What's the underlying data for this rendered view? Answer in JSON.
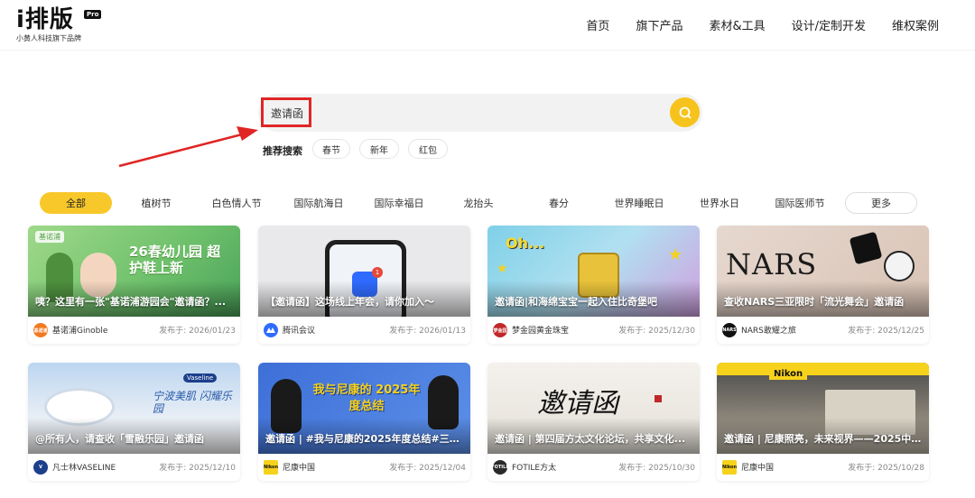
{
  "header": {
    "logo_text": "i排版",
    "logo_badge": "Pro",
    "logo_sub": "小黄人科技旗下品牌",
    "nav": [
      "首页",
      "旗下产品",
      "素材&工具",
      "设计/定制开发",
      "维权案例"
    ]
  },
  "search": {
    "value": "邀请函",
    "recommend_label": "推荐搜索",
    "tags": [
      "春节",
      "新年",
      "红包"
    ]
  },
  "categories": [
    "全部",
    "植树节",
    "白色情人节",
    "国际航海日",
    "国际幸福日",
    "龙抬头",
    "春分",
    "世界睡眠日",
    "世界水日",
    "国际医师节",
    "更多"
  ],
  "cards": [
    {
      "title": "咦？这里有一张\"基诺浦游园会\"邀请函？...",
      "brand": "基诺浦Ginoble",
      "date": "发布于: 2026/01/23",
      "thumb_text": "26春幼儿园 超护鞋上新",
      "badge_text": "基诺浦",
      "avatar_text": "基诺浦",
      "accent": "#7cc576"
    },
    {
      "title": "【邀请函】这场线上年会，请你加入～",
      "brand": "腾讯会议",
      "date": "发布于: 2026/01/13",
      "thumb_text": "",
      "badge_text": "1",
      "avatar_text": "",
      "accent": "#2f6bff"
    },
    {
      "title": "邀请函|和海绵宝宝一起入住比奇堡吧",
      "brand": "梦金园黄金珠宝",
      "date": "发布于: 2025/12/30",
      "thumb_text": "Oh...",
      "badge_text": "",
      "avatar_text": "梦金园",
      "accent": "#c0282a"
    },
    {
      "title": "查收NARS三亚限时「流光舞会」邀请函",
      "brand": "NARS敢耀之旅",
      "date": "发布于: 2025/12/25",
      "thumb_text": "NARS",
      "badge_text": "",
      "avatar_text": "NARS",
      "accent": "#111111"
    },
    {
      "title": "@所有人，请查收「雪融乐园」邀请函",
      "brand": "凡士林VASELINE",
      "date": "发布于: 2025/12/10",
      "thumb_text": "宁波美肌 闪耀乐园",
      "badge_text": "Vaseline",
      "avatar_text": "V",
      "accent": "#1c3f8c"
    },
    {
      "title": "邀请函 | #我与尼康的2025年度总结#三大...",
      "brand": "尼康中国",
      "date": "发布于: 2025/12/04",
      "thumb_text": "我与尼康的 2025年度总结",
      "badge_text": "",
      "avatar_text": "Nikon",
      "accent": "#f6d21c"
    },
    {
      "title": "邀请函 | 第四届方太文化论坛，共享文化...",
      "brand": "FOTILE方太",
      "date": "发布于: 2025/10/30",
      "thumb_text": "邀请函",
      "badge_text": "",
      "avatar_text": "FOTILE",
      "accent": "#2a2a2a"
    },
    {
      "title": "邀请函 | 尼康照亮，未来视界——2025中...",
      "brand": "尼康中国",
      "date": "发布于: 2025/10/28",
      "thumb_text": "Nikon",
      "badge_text": "",
      "avatar_text": "Nikon",
      "accent": "#f6d21c"
    }
  ],
  "colors": {
    "accent_yellow": "#f8c82a",
    "highlight_red": "#e02525"
  }
}
